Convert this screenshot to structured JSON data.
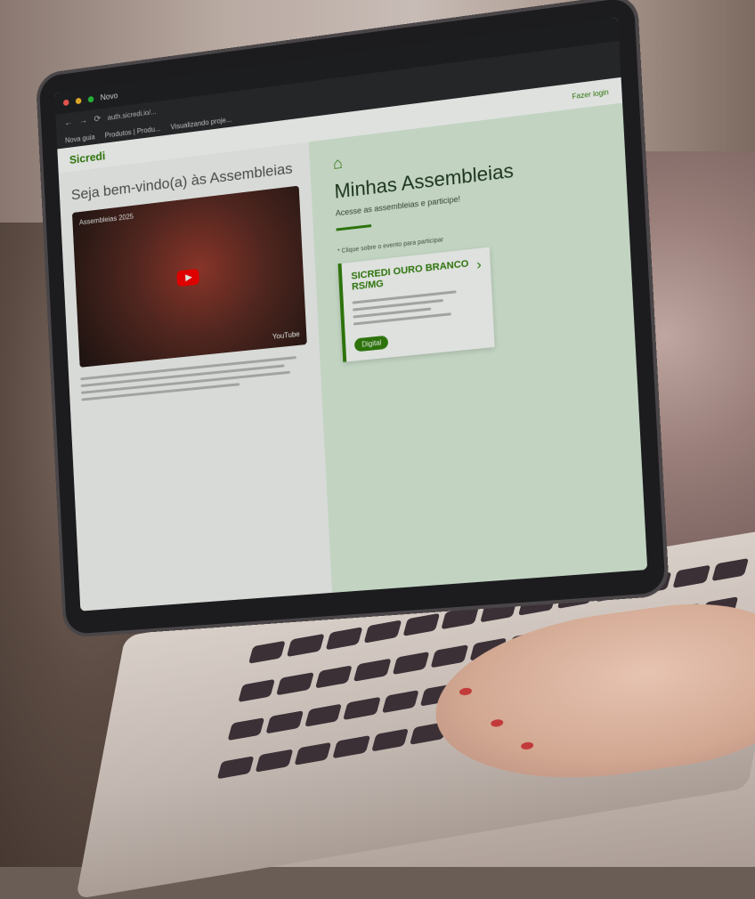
{
  "browser": {
    "tab_title": "Novo",
    "url": "auth.sicredi.io/...",
    "bookmarks": [
      "Nova guia",
      "Produtos | Produ...",
      "Visualizando proje..."
    ]
  },
  "app": {
    "brand": "Sicredi",
    "login_hint": "Fazer login"
  },
  "left": {
    "welcome": "Seja bem-vindo(a) às Assembleias",
    "video": {
      "channel_title": "Assembleias 2025",
      "overlay_text": "",
      "provider": "YouTube"
    }
  },
  "right": {
    "title": "Minhas Assembleias",
    "subtitle": "Acesse as assembleias e participe!",
    "hint": "* Clique sobre o evento para participar",
    "card": {
      "name": "SICREDI OURO BRANCO RS/MG",
      "badge": "Digital"
    }
  },
  "colors": {
    "brand_green": "#33820d",
    "panel_green": "#dff0df",
    "side_button_blue": "#0a5ea8"
  },
  "icons": {
    "play": "play-icon",
    "chevron": "chevron-right-icon",
    "people": "people-icon"
  }
}
